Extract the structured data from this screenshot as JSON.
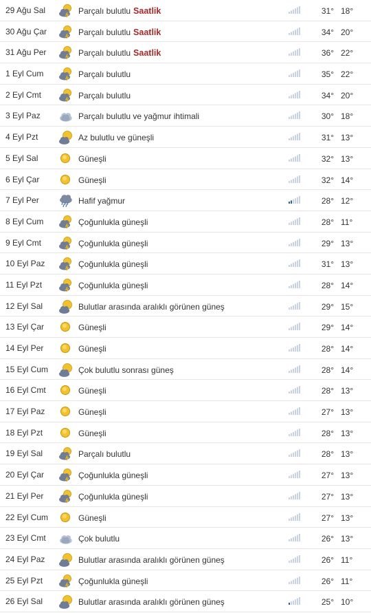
{
  "forecast": {
    "link_label": "Saatlik",
    "rows": [
      {
        "day": "29 Ağu Sal",
        "icon": "partly-cloudy-icon",
        "desc": "Parçalı bulutlu",
        "link": true,
        "rain": 0,
        "hi": "31°",
        "lo": "18°"
      },
      {
        "day": "30 Ağu Çar",
        "icon": "partly-cloudy-icon",
        "desc": "Parçalı bulutlu",
        "link": true,
        "rain": 0,
        "hi": "34°",
        "lo": "20°"
      },
      {
        "day": "31 Ağu Per",
        "icon": "partly-cloudy-icon",
        "desc": "Parçalı bulutlu",
        "link": true,
        "rain": 0,
        "hi": "36°",
        "lo": "22°"
      },
      {
        "day": "1 Eyl Cum",
        "icon": "partly-cloudy-icon",
        "desc": "Parçalı bulutlu",
        "link": false,
        "rain": 0,
        "hi": "35°",
        "lo": "22°"
      },
      {
        "day": "2 Eyl Cmt",
        "icon": "partly-cloudy-icon",
        "desc": "Parçalı bulutlu",
        "link": false,
        "rain": 0,
        "hi": "34°",
        "lo": "20°"
      },
      {
        "day": "3 Eyl Paz",
        "icon": "cloud-rain-chance-icon",
        "desc": "Parçalı bulutlu ve yağmur ihtimali",
        "link": false,
        "rain": 0,
        "hi": "30°",
        "lo": "18°"
      },
      {
        "day": "4 Eyl Pzt",
        "icon": "sun-behind-cloud-icon",
        "desc": "Az bulutlu ve güneşli",
        "link": false,
        "rain": 0,
        "hi": "31°",
        "lo": "13°"
      },
      {
        "day": "5 Eyl Sal",
        "icon": "sun-icon",
        "desc": "Güneşli",
        "link": false,
        "rain": 0,
        "hi": "32°",
        "lo": "13°"
      },
      {
        "day": "6 Eyl Çar",
        "icon": "sun-icon",
        "desc": "Güneşli",
        "link": false,
        "rain": 0,
        "hi": "32°",
        "lo": "14°"
      },
      {
        "day": "7 Eyl Per",
        "icon": "rain-cloud-icon",
        "desc": "Hafif yağmur",
        "link": false,
        "rain": 2,
        "hi": "28°",
        "lo": "12°"
      },
      {
        "day": "8 Eyl Cum",
        "icon": "partly-cloudy-icon",
        "desc": "Çoğunlukla güneşli",
        "link": false,
        "rain": 0,
        "hi": "28°",
        "lo": "11°"
      },
      {
        "day": "9 Eyl Cmt",
        "icon": "partly-cloudy-icon",
        "desc": "Çoğunlukla güneşli",
        "link": false,
        "rain": 0,
        "hi": "29°",
        "lo": "13°"
      },
      {
        "day": "10 Eyl Paz",
        "icon": "partly-cloudy-icon",
        "desc": "Çoğunlukla güneşli",
        "link": false,
        "rain": 0,
        "hi": "31°",
        "lo": "13°"
      },
      {
        "day": "11 Eyl Pzt",
        "icon": "partly-cloudy-icon",
        "desc": "Çoğunlukla güneşli",
        "link": false,
        "rain": 0,
        "hi": "28°",
        "lo": "14°"
      },
      {
        "day": "12 Eyl Sal",
        "icon": "sun-behind-cloud-icon",
        "desc": "Bulutlar arasında aralıklı görünen güneş",
        "link": false,
        "rain": 0,
        "hi": "29°",
        "lo": "15°"
      },
      {
        "day": "13 Eyl Çar",
        "icon": "sun-icon",
        "desc": "Güneşli",
        "link": false,
        "rain": 0,
        "hi": "29°",
        "lo": "14°"
      },
      {
        "day": "14 Eyl Per",
        "icon": "sun-icon",
        "desc": "Güneşli",
        "link": false,
        "rain": 0,
        "hi": "28°",
        "lo": "14°"
      },
      {
        "day": "15 Eyl Cum",
        "icon": "sun-behind-cloud-icon",
        "desc": "Çok bulutlu sonrası güneş",
        "link": false,
        "rain": 0,
        "hi": "28°",
        "lo": "14°"
      },
      {
        "day": "16 Eyl Cmt",
        "icon": "sun-icon",
        "desc": "Güneşli",
        "link": false,
        "rain": 0,
        "hi": "28°",
        "lo": "13°"
      },
      {
        "day": "17 Eyl Paz",
        "icon": "sun-icon",
        "desc": "Güneşli",
        "link": false,
        "rain": 0,
        "hi": "27°",
        "lo": "13°"
      },
      {
        "day": "18 Eyl Pzt",
        "icon": "sun-icon",
        "desc": "Güneşli",
        "link": false,
        "rain": 0,
        "hi": "28°",
        "lo": "13°"
      },
      {
        "day": "19 Eyl Sal",
        "icon": "partly-cloudy-icon",
        "desc": "Parçalı bulutlu",
        "link": false,
        "rain": 0,
        "hi": "28°",
        "lo": "13°"
      },
      {
        "day": "20 Eyl Çar",
        "icon": "partly-cloudy-icon",
        "desc": "Çoğunlukla güneşli",
        "link": false,
        "rain": 0,
        "hi": "27°",
        "lo": "13°"
      },
      {
        "day": "21 Eyl Per",
        "icon": "partly-cloudy-icon",
        "desc": "Çoğunlukla güneşli",
        "link": false,
        "rain": 0,
        "hi": "27°",
        "lo": "13°"
      },
      {
        "day": "22 Eyl Cum",
        "icon": "sun-icon",
        "desc": "Güneşli",
        "link": false,
        "rain": 0,
        "hi": "27°",
        "lo": "13°"
      },
      {
        "day": "23 Eyl Cmt",
        "icon": "cloud-icon",
        "desc": "Çok bulutlu",
        "link": false,
        "rain": 0,
        "hi": "26°",
        "lo": "13°"
      },
      {
        "day": "24 Eyl Paz",
        "icon": "sun-behind-cloud-icon",
        "desc": "Bulutlar arasında aralıklı görünen güneş",
        "link": false,
        "rain": 0,
        "hi": "26°",
        "lo": "11°"
      },
      {
        "day": "25 Eyl Pzt",
        "icon": "partly-cloudy-icon",
        "desc": "Çoğunlukla güneşli",
        "link": false,
        "rain": 0,
        "hi": "26°",
        "lo": "11°"
      },
      {
        "day": "26 Eyl Sal",
        "icon": "sun-behind-cloud-icon",
        "desc": "Bulutlar arasında aralıklı görünen güneş",
        "link": false,
        "rain": 1,
        "hi": "25°",
        "lo": "10°"
      }
    ]
  },
  "colors": {
    "link": "#a52a2a",
    "sun": "#e8b820",
    "cloud": "#8a95a8",
    "bar_empty": "#c7d3e3",
    "bar_filled": "#2f5f98"
  }
}
